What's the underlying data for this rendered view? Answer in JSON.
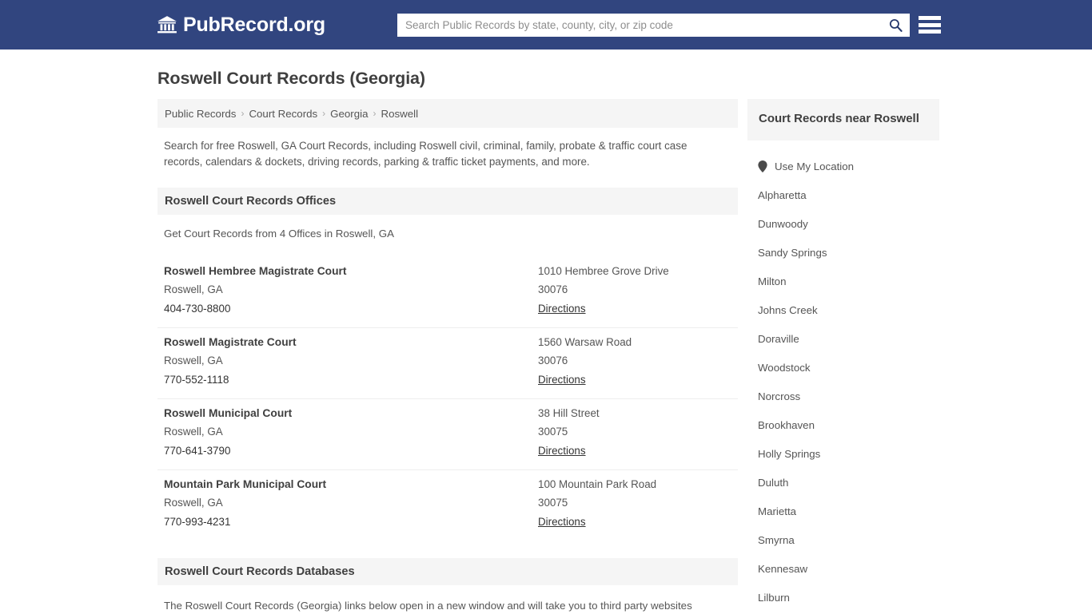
{
  "header": {
    "brand_text": "PubRecord.org",
    "brand_icon": "bank-building-icon",
    "search_placeholder": "Search Public Records by state, county, city, or zip code",
    "search_value": "",
    "search_icon": "search-icon",
    "menu_icon": "hamburger-menu-icon",
    "brand_bg_color": "#31457f"
  },
  "page": {
    "title": "Roswell Court Records (Georgia)",
    "intro": "Search for free Roswell, GA Court Records, including Roswell civil, criminal, family, probate & traffic court case records, calendars & dockets, driving records, parking & traffic ticket payments, and more."
  },
  "breadcrumb": {
    "separator": "›",
    "items": [
      {
        "label": "Public Records"
      },
      {
        "label": "Court Records"
      },
      {
        "label": "Georgia"
      },
      {
        "label": "Roswell"
      }
    ]
  },
  "offices_section": {
    "heading": "Roswell Court Records Offices",
    "subtitle": "Get Court Records from 4 Offices in Roswell, GA",
    "directions_label": "Directions",
    "items": [
      {
        "name": "Roswell Hembree Magistrate Court",
        "city": "Roswell, GA",
        "phone": "404-730-8800",
        "address": "1010 Hembree Grove Drive",
        "zip": "30076",
        "directions": "Directions"
      },
      {
        "name": "Roswell Magistrate Court",
        "city": "Roswell, GA",
        "phone": "770-552-1118",
        "address": "1560 Warsaw Road",
        "zip": "30076",
        "directions": "Directions"
      },
      {
        "name": "Roswell Municipal Court",
        "city": "Roswell, GA",
        "phone": "770-641-3790",
        "address": "38 Hill Street",
        "zip": "30075",
        "directions": "Directions"
      },
      {
        "name": "Mountain Park Municipal Court",
        "city": "Roswell, GA",
        "phone": "770-993-4231",
        "address": "100 Mountain Park Road",
        "zip": "30075",
        "directions": "Directions"
      }
    ]
  },
  "databases_section": {
    "heading": "Roswell Court Records Databases",
    "note": "The Roswell Court Records (Georgia) links below open in a new window and will take you to third party websites"
  },
  "sidebar": {
    "heading": "Court Records near Roswell",
    "use_my_location": {
      "label": "Use My Location",
      "icon": "map-pin-icon"
    },
    "cities": [
      {
        "label": "Alpharetta"
      },
      {
        "label": "Dunwoody"
      },
      {
        "label": "Sandy Springs"
      },
      {
        "label": "Milton"
      },
      {
        "label": "Johns Creek"
      },
      {
        "label": "Doraville"
      },
      {
        "label": "Woodstock"
      },
      {
        "label": "Norcross"
      },
      {
        "label": "Brookhaven"
      },
      {
        "label": "Holly Springs"
      },
      {
        "label": "Duluth"
      },
      {
        "label": "Marietta"
      },
      {
        "label": "Smyrna"
      },
      {
        "label": "Kennesaw"
      },
      {
        "label": "Lilburn"
      }
    ]
  }
}
